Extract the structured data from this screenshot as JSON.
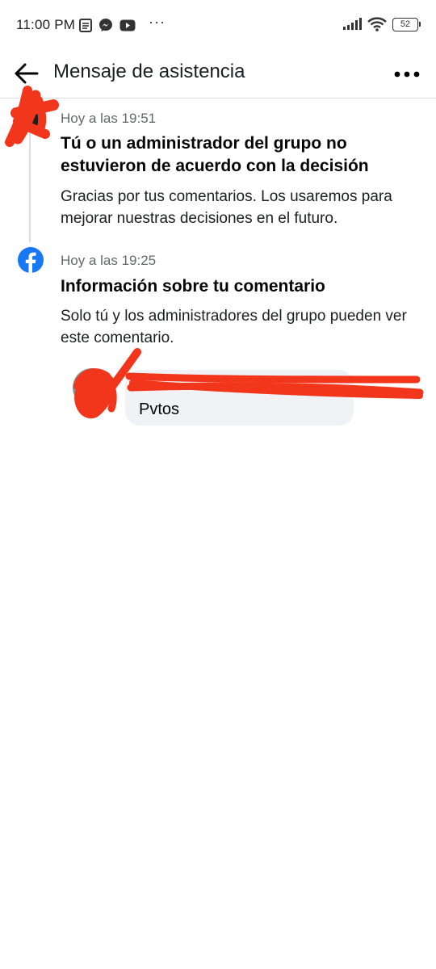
{
  "status_bar": {
    "time": "11:00 PM",
    "more": "···",
    "battery": "52",
    "icons": [
      "notes-icon",
      "messenger-icon",
      "youtube-icon",
      "signal-icon",
      "wifi-icon",
      "battery-icon"
    ]
  },
  "header": {
    "title": "Mensaje de asistencia",
    "back_icon": "back-arrow-icon",
    "menu_icon": "more-horizontal-icon"
  },
  "entries": [
    {
      "time": "Hoy a las 19:51",
      "title": "Tú o un administrador del grupo no estuvieron de acuerdo con la decisión",
      "body": "Gracias por tus comentarios. Los usaremos para mejorar nuestras decisiones en el futuro."
    },
    {
      "time": "Hoy a las 19:25",
      "title": "Información sobre tu comentario",
      "body": "Solo tú y los administradores del grupo pueden ver este comentario.",
      "icon": "facebook-icon"
    }
  ],
  "comment": {
    "author": "",
    "text": "Pvtos"
  },
  "colors": {
    "facebook_blue": "#1877f2",
    "secondary_text": "#65676b",
    "bubble_bg": "#f0f2f5",
    "redaction": "#f2361b"
  }
}
